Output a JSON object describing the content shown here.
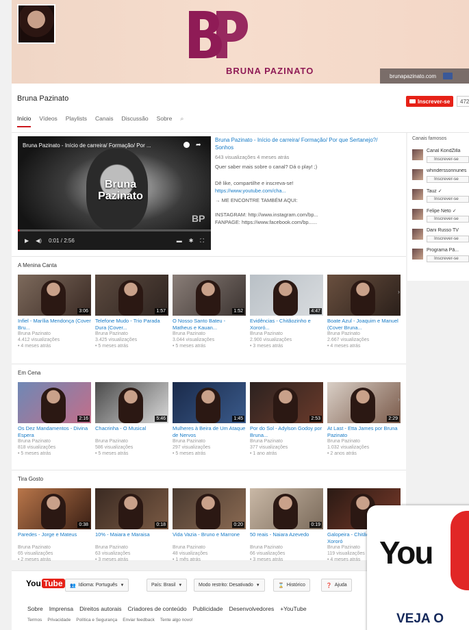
{
  "banner": {
    "brand_name": "BRUNA PAZINATO",
    "site": "brunapazinato.com",
    "accent_color": "#8f1b56"
  },
  "channel": {
    "title": "Bruna Pazinato",
    "subscribe_label": "Inscrever-se",
    "subscriber_count": "472",
    "tabs": [
      {
        "label": "Início",
        "active": true
      },
      {
        "label": "Vídeos"
      },
      {
        "label": "Playlists"
      },
      {
        "label": "Canais"
      },
      {
        "label": "Discussão"
      },
      {
        "label": "Sobre"
      }
    ]
  },
  "featured": {
    "player_title": "Bruna Pazinato - Início de carreira/ Formação/ Por ...",
    "overlay_line1": "Bruna",
    "overlay_line2": "Pazinato",
    "watermark": "BP",
    "time": "0:01 / 2:56",
    "progress": 0.01,
    "info_title": "Bruna Pazinato - Início de carreira/ Formação/ Por que Sertanejo?/ Sonhos",
    "info_meta": "643 visualizações  4 meses atrás",
    "info_desc": "Quer saber mais sobre o canal? Dá o play! ;)",
    "info_like": "Dê like, compartilhe e inscreva-se!",
    "info_link": "https://www.youtube.com/cha...",
    "info_find": "→ ME ENCONTRE TAMBÉM AQUI:",
    "info_insta": "INSTAGRAM: http://www.instagram.com/bp...",
    "info_fb": "FANPAGE: https://www.facebook.com/bp......"
  },
  "sections": [
    {
      "title": "A Menina Canta",
      "videos": [
        {
          "title": "Infiel - Marília Mendonça (Cover Bru...",
          "channel": "Bruna Pazinato",
          "views": "4.412 visualizações",
          "age": "• 4 meses atrás",
          "duration": "3:06"
        },
        {
          "title": "Telefone Mudo - Trio Parada Dura (Cover...",
          "channel": "Bruna Pazinato",
          "views": "3.425 visualizações",
          "age": "• 5 meses atrás",
          "duration": "1:57"
        },
        {
          "title": "O Nosso Santo Bateu - Matheus e Kauan...",
          "channel": "Bruna Pazinato",
          "views": "3.044 visualizações",
          "age": "• 5 meses atrás",
          "duration": "1:52"
        },
        {
          "title": "Evidências - Chitãozinho e Xororó...",
          "channel": "Bruna Pazinato",
          "views": "2.900 visualizações",
          "age": "• 3 meses atrás",
          "duration": "4:47"
        },
        {
          "title": "Boate Azul - Joaquim e Manuel (Cover Bruna...",
          "channel": "Bruna Pazinato",
          "views": "2.667 visualizações",
          "age": "• 4 meses atrás",
          "duration": ""
        }
      ]
    },
    {
      "title": "Em Cena",
      "videos": [
        {
          "title": "Os Dez Mandamentos - Divina Espera",
          "channel": "Bruna Pazinato",
          "views": "818 visualizações",
          "age": "• 5 meses atrás",
          "duration": "2:16"
        },
        {
          "title": "Chacrinha - O Musical",
          "channel": "Bruna Pazinato",
          "views": "586 visualizações",
          "age": "• 5 meses atrás",
          "duration": "5:46"
        },
        {
          "title": "Mulheres à Beira de Um Ataque de Nervos",
          "channel": "Bruna Pazinato",
          "views": "297 visualizações",
          "age": "• 5 meses atrás",
          "duration": "1:45"
        },
        {
          "title": "Por do Sol - Adylson Godoy por Bruna...",
          "channel": "Bruna Pazinato",
          "views": "377 visualizações",
          "age": "• 1 ano atrás",
          "duration": "2:53"
        },
        {
          "title": "At Last - Etta James por Bruna Pazinato",
          "channel": "Bruna Pazinato",
          "views": "1.032 visualizações",
          "age": "• 2 anos atrás",
          "duration": "2:29"
        }
      ]
    },
    {
      "title": "Tira Gosto",
      "videos": [
        {
          "title": "Paredes - Jorge e Mateus",
          "channel": "Bruna Pazinato",
          "views": "65 visualizações",
          "age": "• 2 meses atrás",
          "duration": "0:38"
        },
        {
          "title": "10% - Maiara e Maraisa",
          "channel": "Bruna Pazinato",
          "views": "63 visualizações",
          "age": "• 3 meses atrás",
          "duration": "0:18"
        },
        {
          "title": "Vida Vazia - Bruno e Marrone",
          "channel": "Bruna Pazinato",
          "views": "48 visualizações",
          "age": "• 1 mês atrás",
          "duration": "0:20"
        },
        {
          "title": "50 reais - Naiara Azevedo",
          "channel": "Bruna Pazinato",
          "views": "66 visualizações",
          "age": "• 3 meses atrás",
          "duration": "0:19"
        },
        {
          "title": "Galopeira - Chitãozinho e Xororó",
          "channel": "Bruna Pazinato",
          "views": "119 visualizações",
          "age": "• 4 meses atrás",
          "duration": ""
        }
      ]
    }
  ],
  "side": {
    "title": "Canais famosos",
    "channels": [
      {
        "name": "Canal KondZilla",
        "sub": "Inscrever-se"
      },
      {
        "name": "whinderssonnunes",
        "sub": "Inscrever-se"
      },
      {
        "name": "Tauz ✓",
        "sub": "Inscrever-se"
      },
      {
        "name": "Felipe Neto ✓",
        "sub": "Inscrever-se"
      },
      {
        "name": "Dani Russo TV",
        "sub": "Inscrever-se"
      },
      {
        "name": "Programa Pã...",
        "sub": "Inscrever-se"
      }
    ]
  },
  "footer": {
    "logo_you": "You",
    "logo_tube": "Tube",
    "language": "Idioma: Português",
    "country": "País: Brasil",
    "restricted": "Modo restrito: Desativado",
    "history": "Histórico",
    "help": "Ajuda",
    "links": [
      "Sobre",
      "Imprensa",
      "Direitos autorais",
      "Criadores de conteúdo",
      "Publicidade",
      "Desenvolvedores",
      "+YouTube"
    ],
    "small_links": [
      "Termos",
      "Privacidade",
      "Política e Segurança",
      "Enviar feedback",
      "Tente algo novo!"
    ]
  },
  "promo": {
    "logo_text": "You",
    "cta": "VEJA O"
  }
}
